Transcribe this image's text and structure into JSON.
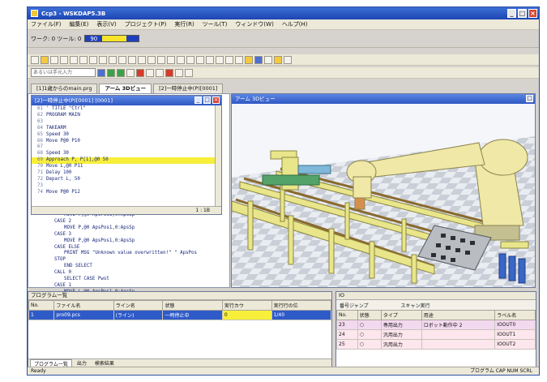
{
  "window": {
    "title": "Ccp3 - WSKDAP5.3B"
  },
  "menu": [
    "ファイル(F)",
    "編集(E)",
    "表示(V)",
    "プロジェクト(P)",
    "実行(R)",
    "ツール(T)",
    "ウィンドウ(W)",
    "ヘルプ(H)"
  ],
  "statusline": {
    "label": "ワーク: 0 ツール: 0",
    "meter": "90"
  },
  "toolbar3": {
    "combo": "あるいは手元入力"
  },
  "tabs": [
    "[1]1歳からのmain.prg",
    "アーム 3Dビュー",
    "[2]一時停止中(P)[0001]"
  ],
  "editor": {
    "title": "[2]一時停止中(P)[0001] [0001]",
    "lines": [
      {
        "n": "61",
        "t": "' TITLE \"Ctrl\"",
        "hl": false
      },
      {
        "n": "62",
        "t": "PROGRAM MAIN",
        "hl": false
      },
      {
        "n": "63",
        "t": "",
        "hl": false
      },
      {
        "n": "64",
        "t": "TAKEARM",
        "hl": false
      },
      {
        "n": "65",
        "t": "Speed 30",
        "hl": false
      },
      {
        "n": "66",
        "t": "Move P@0 P10",
        "hl": false
      },
      {
        "n": "67",
        "t": "",
        "hl": false
      },
      {
        "n": "68",
        "t": "Speed 30",
        "hl": false
      },
      {
        "n": "69",
        "t": "Approach P, P[1],@0 50",
        "hl": true
      },
      {
        "n": "70",
        "t": "Move L,@0 P11",
        "hl": false
      },
      {
        "n": "71",
        "t": "Delay 100",
        "hl": false
      },
      {
        "n": "72",
        "t": "Depart L, 50",
        "hl": false
      },
      {
        "n": "73",
        "t": "",
        "hl": false
      },
      {
        "n": "74",
        "t": "Move P@0 P12",
        "hl": false
      }
    ],
    "footer": "1 : 1B",
    "lower_lines": [
      {
        "n": "",
        "t": "MOVE P,@0 ApsPos1,0:ApsSp"
      },
      {
        "n": "",
        "t": "CASE 2"
      },
      {
        "n": "",
        "t": "MOVE P,@0 ApsPos1,0:ApsSp"
      },
      {
        "n": "",
        "t": "CASE 3"
      },
      {
        "n": "",
        "t": "MOVE P,@0 ApsPos1,0:ApsSp"
      },
      {
        "n": "",
        "t": "CASE ELSE"
      },
      {
        "n": "",
        "t": "PRINT MSG \"Unknown value overwritten!\" \" ApsPos"
      },
      {
        "n": "",
        "t": "STOP"
      },
      {
        "n": "",
        "t": "END SELECT"
      },
      {
        "n": "",
        "t": "CALL 0"
      },
      {
        "n": "",
        "t": "SELECT CASE Pwst"
      },
      {
        "n": "",
        "t": "CASE 1"
      },
      {
        "n": "",
        "t": "MOVE L,@0 ApsPos1,0:ApsSp"
      }
    ]
  },
  "view3d": {
    "title": "アーム 3Dビュー"
  },
  "programs": {
    "title": "プログラム一覧",
    "columns": [
      "No.",
      "ファイル名",
      "ライン名",
      "状態",
      "実行カウ",
      "実行行の位"
    ],
    "rows": [
      {
        "no": "1",
        "file": "pro09.pcs",
        "line": "(ライン)",
        "state": "一時停止中",
        "count": "0",
        "pos": "1/40"
      }
    ],
    "tabs": [
      "プログラム一覧",
      "出力",
      "検索結果"
    ]
  },
  "io": {
    "title": "IO",
    "filter_label": "番号ジャンプ",
    "filter_btn": "スキャン実行",
    "columns": [
      "No.",
      "状態",
      "タイプ",
      "用途",
      "ラベル名"
    ],
    "rows": [
      {
        "no": "23",
        "type": "専用出力",
        "use": "ロボット動作中 2",
        "label": "IOOUT0"
      },
      {
        "no": "24",
        "type": "汎用出力",
        "use": "",
        "label": "IOOUT1"
      },
      {
        "no": "25",
        "type": "汎用出力",
        "use": "",
        "label": "IOOUT2"
      }
    ]
  },
  "statusbar": {
    "left": "Ready",
    "right": "プログラム CAP NUM SCRL"
  }
}
